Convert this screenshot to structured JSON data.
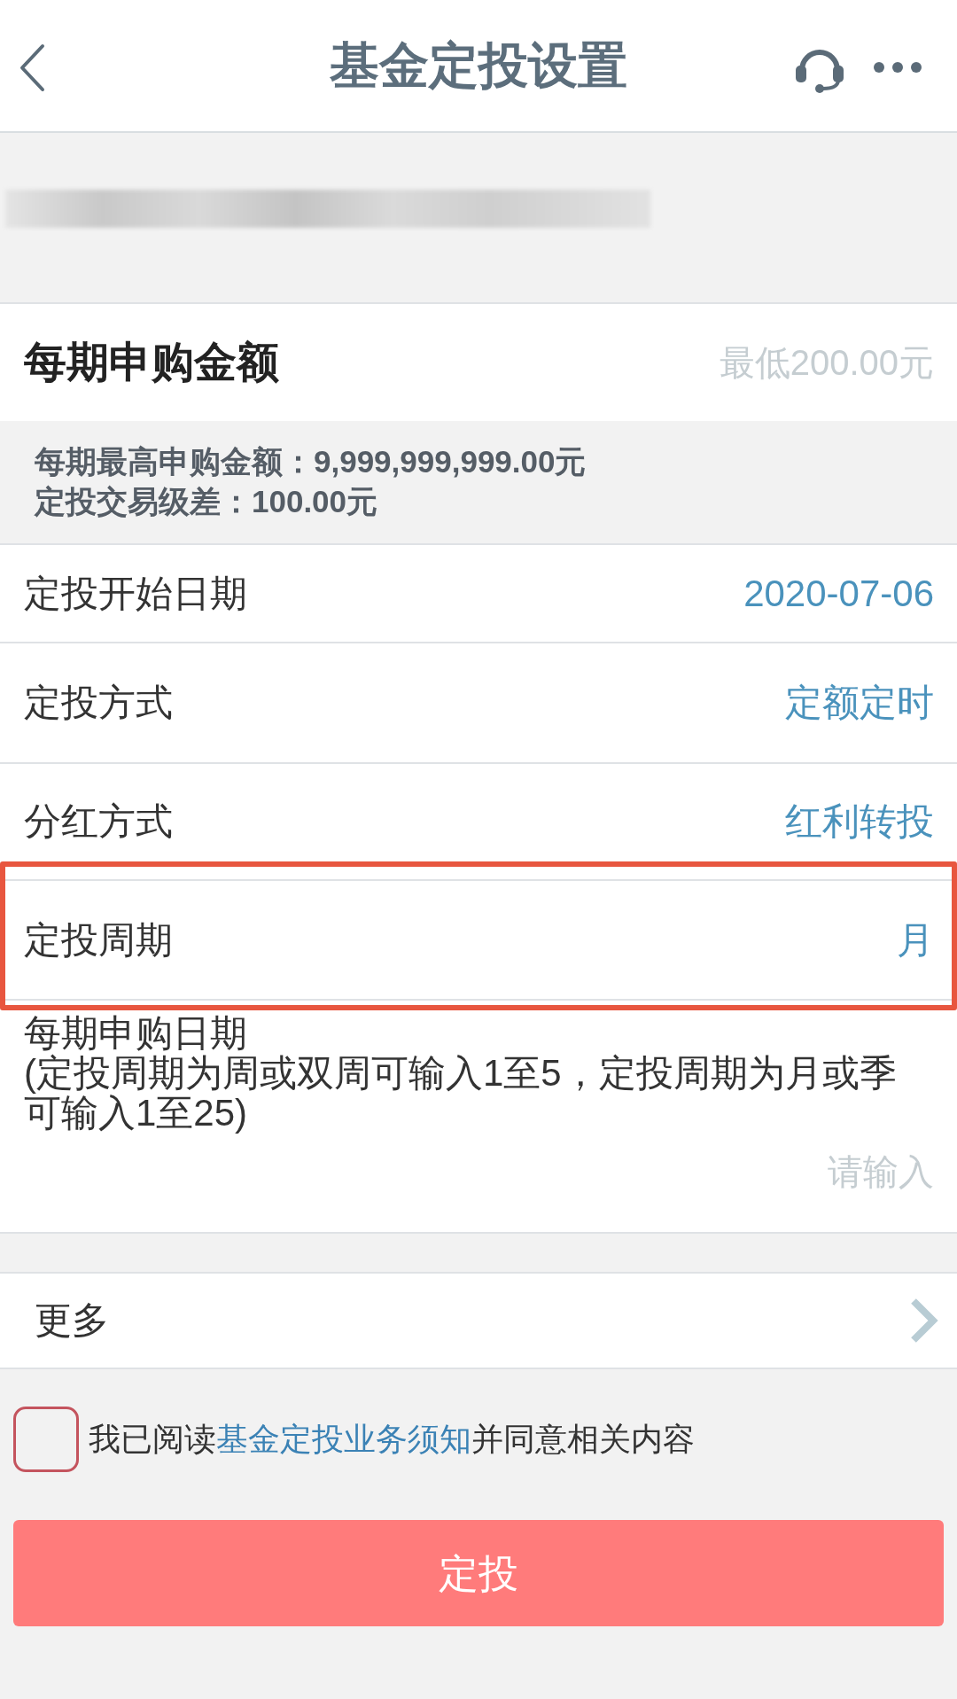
{
  "header": {
    "title": "基金定投设置"
  },
  "amount": {
    "label": "每期申购金额",
    "placeholder": "最低200.00元"
  },
  "limits": [
    "每期最高申购金额：9,999,999,999.00元",
    "定投交易级差：100.00元"
  ],
  "settings": [
    {
      "label": "定投开始日期",
      "value": "2020-07-06",
      "highlighted": false
    },
    {
      "label": "定投方式",
      "value": "定额定时",
      "highlighted": false
    },
    {
      "label": "分红方式",
      "value": "红利转投",
      "highlighted": false
    },
    {
      "label": "定投周期",
      "value": "月",
      "highlighted": true
    }
  ],
  "purchase_date": {
    "label": "每期申购日期",
    "hint": "(定投周期为周或双周可输入1至5，定投周期为月或季可输入1至25)",
    "placeholder": "请输入"
  },
  "more": {
    "label": "更多"
  },
  "agreement": {
    "checked": false,
    "text_before": "我已阅读",
    "link": "基金定投业务须知",
    "text_after": "并同意相关内容"
  },
  "submit_button": {
    "label": "定投"
  }
}
